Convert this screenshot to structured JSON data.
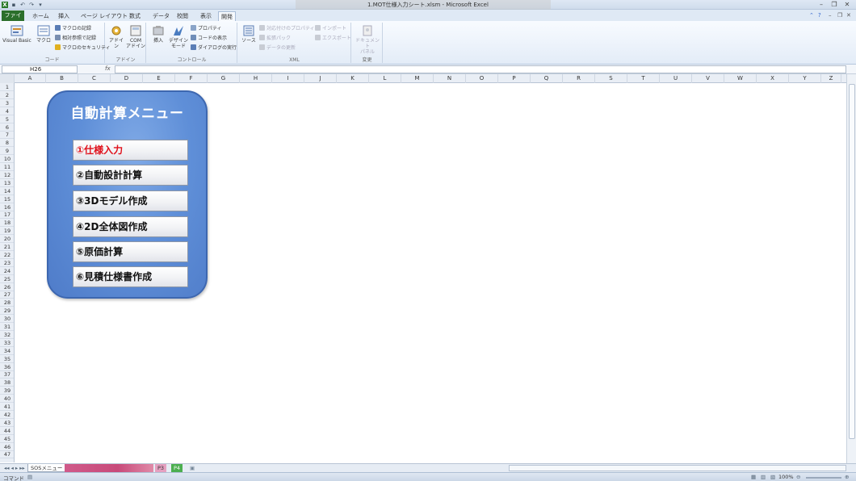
{
  "window": {
    "title": "1.MOT仕様入力シート.xlsm - Microsoft Excel"
  },
  "ribbon_tabs": [
    {
      "label": "ファイル"
    },
    {
      "label": "ホーム"
    },
    {
      "label": "挿入"
    },
    {
      "label": "ページ レイアウト"
    },
    {
      "label": "数式"
    },
    {
      "label": "データ"
    },
    {
      "label": "校閲"
    },
    {
      "label": "表示"
    },
    {
      "label": "開発"
    }
  ],
  "ribbon": {
    "code_group": {
      "label": "コード",
      "visual_basic": "Visual Basic",
      "macro": "マクロ",
      "record_macro": "マクロの記録",
      "relative_ref": "相対参照で記録",
      "macro_security": "マクロのセキュリティ"
    },
    "addin_group": {
      "label": "アドイン",
      "addin": "アドイン",
      "com_addin_1": "COM",
      "com_addin_2": "アドイン"
    },
    "control_group": {
      "label": "コントロール",
      "insert": "挿入",
      "design_mode_1": "デザイン",
      "design_mode_2": "モード",
      "properties": "プロパティ",
      "view_code": "コードの表示",
      "run_dialog": "ダイアログの実行"
    },
    "xml_group": {
      "label": "XML",
      "source": "ソース",
      "map_props": "対応付けのプロパティ",
      "expansion_pack": "拡張パック",
      "refresh_data": "データの更新",
      "import": "インポート",
      "export": "エクスポート"
    },
    "modify_group": {
      "label": "変更",
      "doc_panel_1": "ドキュメント",
      "doc_panel_2": "パネル"
    }
  },
  "formula_bar": {
    "name_box": "H26",
    "fx": "fx"
  },
  "columns": [
    "A",
    "B",
    "C",
    "D",
    "E",
    "F",
    "G",
    "H",
    "I",
    "J",
    "K",
    "L",
    "M",
    "N",
    "O",
    "P",
    "Q",
    "R",
    "S",
    "T",
    "U",
    "V",
    "W",
    "X",
    "Y",
    "Z"
  ],
  "rows": [
    "1",
    "2",
    "3",
    "4",
    "5",
    "6",
    "7",
    "8",
    "9",
    "10",
    "11",
    "12",
    "13",
    "14",
    "15",
    "16",
    "17",
    "18",
    "19",
    "20",
    "21",
    "22",
    "23",
    "24",
    "25",
    "26",
    "27",
    "28",
    "29",
    "30",
    "31",
    "32",
    "33",
    "34",
    "35",
    "36",
    "37",
    "38",
    "39",
    "40",
    "41",
    "42",
    "43",
    "44",
    "45",
    "46",
    "47"
  ],
  "menu": {
    "title": "自動計算メニュー",
    "buttons": [
      {
        "label": "①仕様入力"
      },
      {
        "label": "②自動設計計算"
      },
      {
        "label": "③3Dモデル作成"
      },
      {
        "label": "④2D全体図作成"
      },
      {
        "label": "⑤原価計算"
      },
      {
        "label": "⑥見積仕様書作成"
      }
    ]
  },
  "sheet_tabs": [
    {
      "label": "SOSメニュー"
    },
    {
      "label": "P3"
    },
    {
      "label": "P4"
    }
  ],
  "status": {
    "mode": "コマンド",
    "zoom": "100%"
  },
  "colors": {
    "panel_blue": "#5f8fd8",
    "active_label_red": "#e0101a",
    "file_tab_green": "#2b6f2b"
  }
}
